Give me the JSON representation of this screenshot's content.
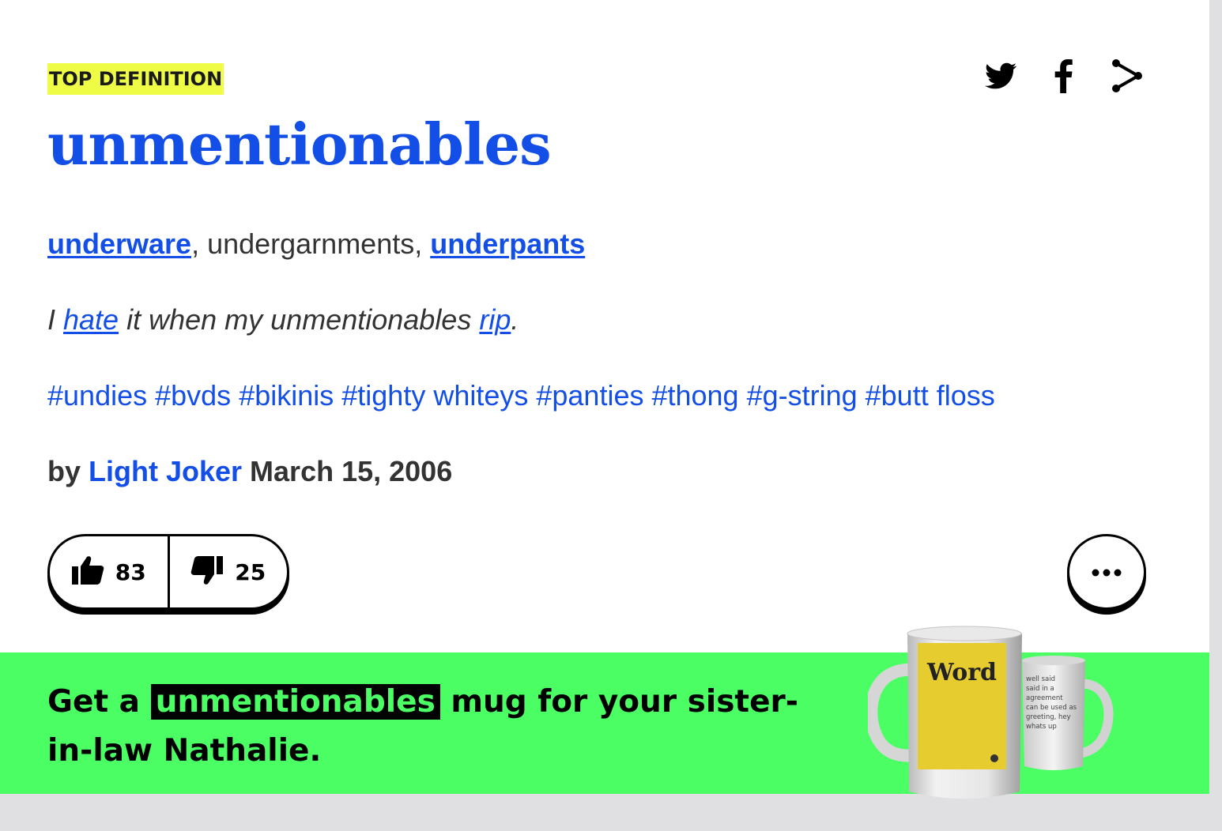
{
  "definition": {
    "label": "TOP DEFINITION",
    "word": "unmentionables",
    "meaning": {
      "link1": "underware",
      "sep1": ", undergarnments, ",
      "link2": "underpants"
    },
    "example": {
      "pre": "I ",
      "link1": "hate",
      "mid": " it when my unmentionables ",
      "link2": "rip",
      "post": "."
    },
    "tags": [
      "#undies",
      "#bvds",
      "#bikinis",
      "#tighty whiteys",
      "#panties",
      "#thong",
      "#g-string",
      "#butt floss"
    ],
    "byline": {
      "by": "by ",
      "author": "Light Joker",
      "date": " March 15, 2006"
    }
  },
  "share_icons": [
    "twitter-icon",
    "facebook-icon",
    "share-icon"
  ],
  "votes": {
    "up": "83",
    "down": "25"
  },
  "more_icon": "ellipsis-icon",
  "promo": {
    "pre": "Get a ",
    "highlight": "unmentionables",
    "post": " mug for your sister-in-law Nathalie.",
    "mug_front_text": "Word",
    "mug_back_lines": [
      "well said",
      "said in a",
      "agreement",
      "can be used as",
      "greeting, hey",
      "whats up"
    ]
  },
  "colors": {
    "link_blue": "#134fe6",
    "label_yellow": "#eefc45",
    "promo_green": "#4afe63",
    "mug_yellow": "#e6cc2e"
  }
}
